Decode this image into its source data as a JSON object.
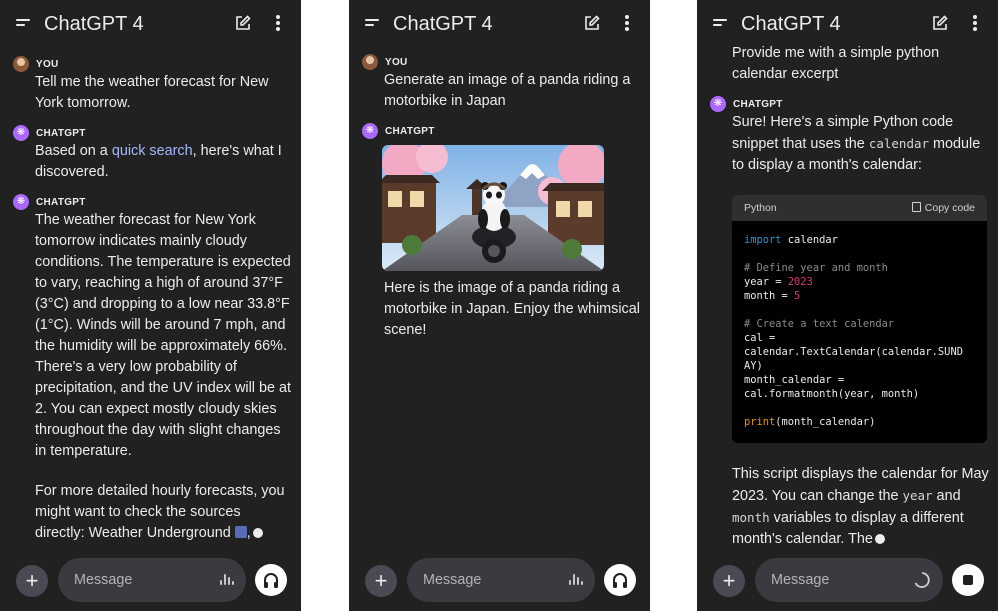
{
  "app": {
    "title": "ChatGPT 4"
  },
  "labels": {
    "you": "YOU",
    "chatgpt": "CHATGPT"
  },
  "composer": {
    "placeholder": "Message"
  },
  "screen1": {
    "user_message": "Tell me the weather forecast for New York tomorrow.",
    "reply1": {
      "before": "Based on a ",
      "link": "quick search",
      "after": ", here's what I discovered."
    },
    "reply2": {
      "para1": "The weather forecast for New York tomorrow indicates mainly cloudy conditions. The temperature is expected to vary, reaching a high of around 37°F (3°C) and dropping to a low near 33.8°F (1°C). Winds will be around 7 mph, and the humidity will be approximately 66%. There's a very low probability of precipitation, and the UV index will be at 2. You can expect mostly cloudy skies throughout the day with slight changes in temperature.",
      "para2": "For more detailed hourly forecasts, you might want to check the sources directly: Weather Underground ",
      "para2_end": ","
    }
  },
  "screen2": {
    "user_message": "Generate an image of a panda riding a motorbike in Japan",
    "reply": "Here is the image of a panda riding a motorbike in Japan. Enjoy the whimsical scene!"
  },
  "screen3": {
    "user_message": "Provide me with a simple python calendar excerpt",
    "intro": {
      "p1": "Sure! Here's a simple Python code snippet that uses the ",
      "code1": "calendar",
      "p2": " module to display a month's calendar:"
    },
    "code": {
      "language": "Python",
      "copy_label": "Copy code",
      "lines": {
        "l1a": "import",
        "l1b": " calendar",
        "l2": "# Define year and month",
        "l3a": "year = ",
        "l3b": "2023",
        "l4a": "month = ",
        "l4b": "5",
        "l5": "# Create a text calendar",
        "l6": "cal =",
        "l7": "calendar.TextCalendar(calendar.SUND",
        "l8": "AY)",
        "l9": "month_calendar =",
        "l10": "cal.formatmonth(year, month)",
        "l11a": "print",
        "l11b": "(month_calendar)"
      }
    },
    "outro": {
      "p1": "This script displays the calendar for May 2023. You can change the ",
      "code1": "year",
      "p2": " and ",
      "code2": "month",
      "p3": " variables to display a different month's calendar. The"
    }
  },
  "icons": [
    "menu-icon",
    "edit-icon",
    "more-vert-icon",
    "plus-icon",
    "voice-wave-icon",
    "headphones-icon",
    "loading-spinner-icon",
    "stop-icon",
    "copy-icon"
  ]
}
